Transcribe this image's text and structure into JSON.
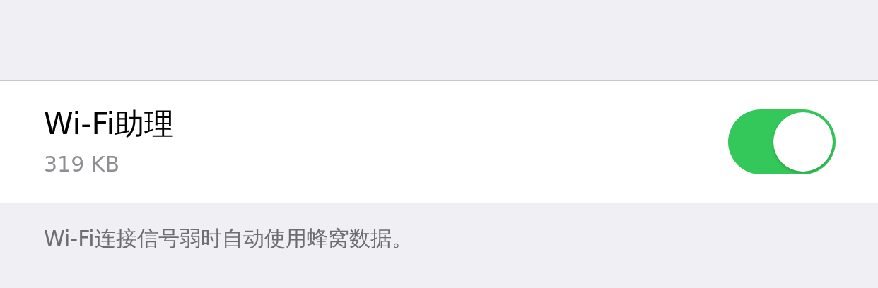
{
  "setting": {
    "title": "Wi-Fi助理",
    "subtitle": "319 KB",
    "on": true
  },
  "footer": "Wi-Fi连接信号弱时自动使用蜂窝数据。"
}
